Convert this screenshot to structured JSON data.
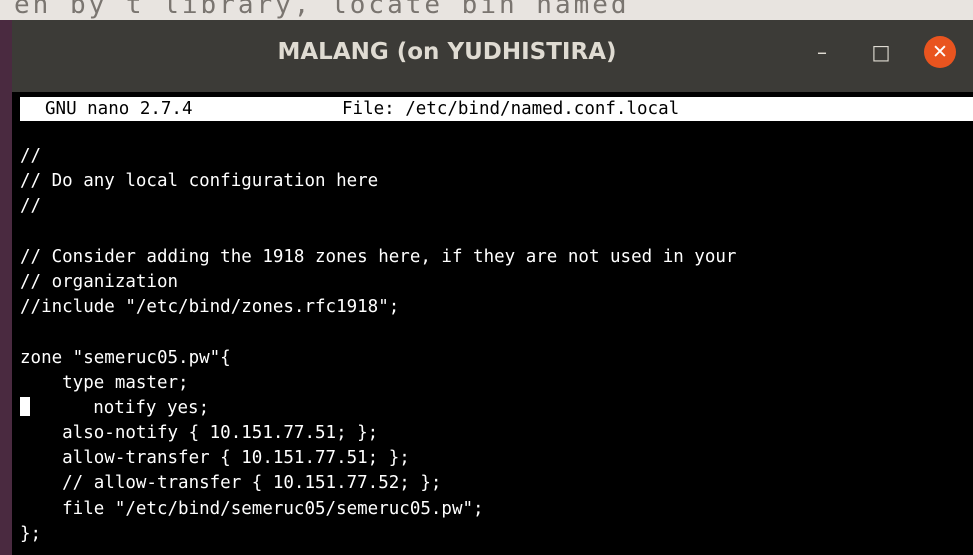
{
  "background": {
    "partial_text": "en by t library, locate bin named"
  },
  "window": {
    "title": "MALANG (on YUDHISTIRA)",
    "controls": {
      "minimize": "–",
      "maximize": "□",
      "close": "✕"
    }
  },
  "nano": {
    "version": "GNU nano 2.7.4",
    "file": "File: /etc/bind/named.conf.local"
  },
  "editor": {
    "lines": [
      "//",
      "// Do any local configuration here",
      "//",
      "",
      "// Consider adding the 1918 zones here, if they are not used in your",
      "// organization",
      "//include \"/etc/bind/zones.rfc1918\";",
      "",
      "zone \"semeruc05.pw\"{",
      "    type master;",
      "    notify yes;",
      "    also-notify { 10.151.77.51; };",
      "    allow-transfer { 10.151.77.51; };",
      "    // allow-transfer { 10.151.77.52; };",
      "    file \"/etc/bind/semeruc05/semeruc05.pw\";",
      "};"
    ]
  },
  "colors": {
    "titlebar": "#3c3b37",
    "close_button": "#e9541f",
    "terminal_bg": "#000000",
    "terminal_fg": "#ffffff"
  }
}
